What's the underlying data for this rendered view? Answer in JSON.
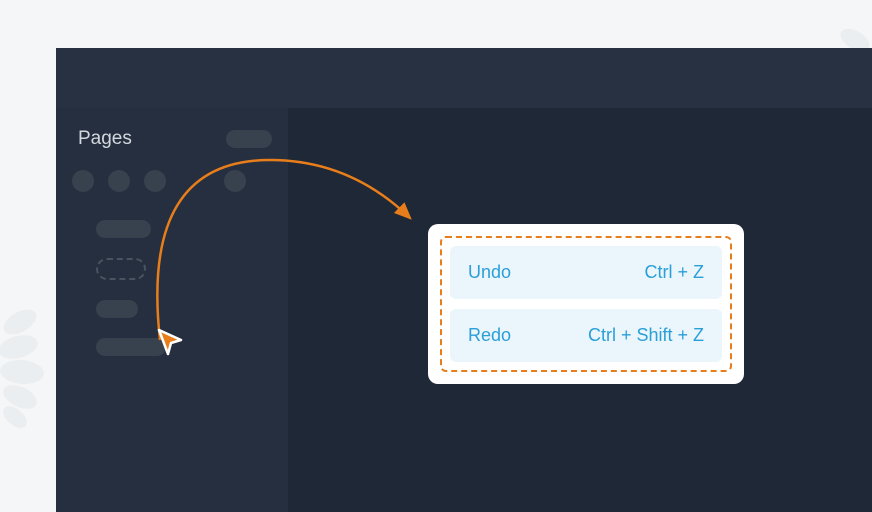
{
  "sidebar": {
    "title": "Pages"
  },
  "shortcuts": {
    "items": [
      {
        "action": "Undo",
        "keys": "Ctrl + Z"
      },
      {
        "action": "Redo",
        "keys": "Ctrl + Shift + Z"
      }
    ]
  },
  "colors": {
    "accent": "#e87e1b",
    "shortcut_bg": "#eaf5fc",
    "shortcut_text": "#2a9fd8",
    "app_dark": "#1e2836",
    "sidebar": "#252f3f"
  }
}
